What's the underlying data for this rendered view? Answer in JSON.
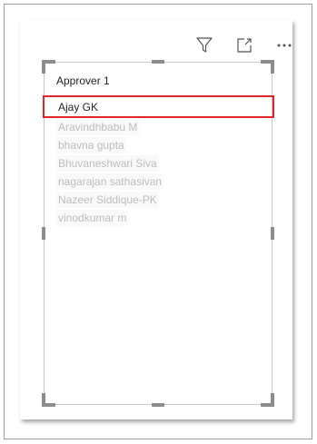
{
  "slicer": {
    "title": "Approver 1",
    "items": [
      {
        "label": "Ajay GK",
        "selected": true
      },
      {
        "label": "Aravindhbabu M",
        "selected": false
      },
      {
        "label": "bhavna gupta",
        "selected": false
      },
      {
        "label": "Bhuvaneshwari Siva",
        "selected": false
      },
      {
        "label": "nagarajan sathasivan",
        "selected": false
      },
      {
        "label": "Nazeer Siddique-PK",
        "selected": false
      },
      {
        "label": "vinodkumar m",
        "selected": false
      }
    ]
  },
  "header": {
    "icons": [
      "filter-icon",
      "focus-mode-icon",
      "more-options-icon"
    ]
  },
  "colors": {
    "highlight": "#e0262b",
    "unselected_text": "#bdbdbd",
    "selected_text": "#252423"
  }
}
